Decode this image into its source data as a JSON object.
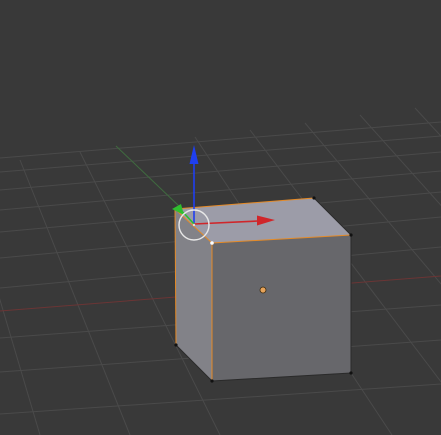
{
  "viewport": {
    "background": "#393939",
    "grid_color": "#4a4a4a",
    "x_axis_color": "#6b3535",
    "y_axis_color": "#3f6b3f"
  },
  "object": {
    "type": "cube",
    "selected": true,
    "outline_color": "#e58a26",
    "origin_color": "#e6a35a",
    "face_colors": {
      "top": "#9c9ca8",
      "front": "#67676b",
      "left": "#828288"
    }
  },
  "gizmo": {
    "type": "translate",
    "axes": [
      {
        "axis": "x",
        "color": "#d0262a"
      },
      {
        "axis": "y",
        "color": "#2fbf2f"
      },
      {
        "axis": "z",
        "color": "#1f3ff0"
      }
    ],
    "circle_color": "#e8e8e8"
  }
}
